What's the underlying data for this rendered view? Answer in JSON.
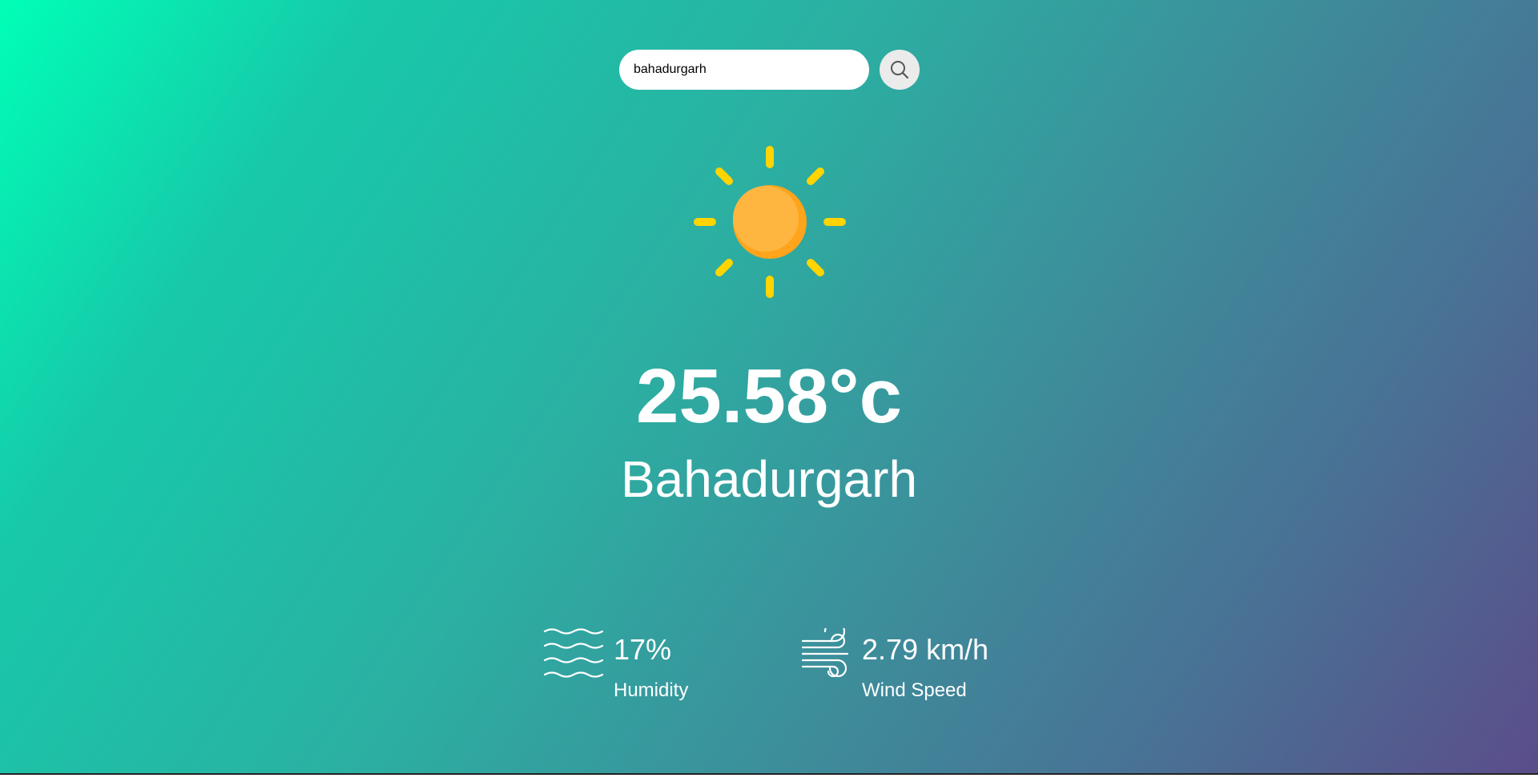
{
  "search": {
    "value": "bahadurgarh",
    "button_icon": "search-icon"
  },
  "weather": {
    "icon": "sun-icon",
    "temperature": "25.58°c",
    "city": "Bahadurgarh"
  },
  "details": {
    "humidity": {
      "icon": "humidity-waves-icon",
      "value": "17%",
      "label": "Humidity"
    },
    "wind": {
      "icon": "wind-icon",
      "value": "2.79 km/h",
      "label": "Wind Speed"
    }
  },
  "colors": {
    "gradient_start": "#00ffb7",
    "gradient_end": "#5b4d8a",
    "sun_core": "#ffb640",
    "sun_shade": "#ffa41b",
    "sun_rays": "#ffd400",
    "text": "#ffffff"
  }
}
